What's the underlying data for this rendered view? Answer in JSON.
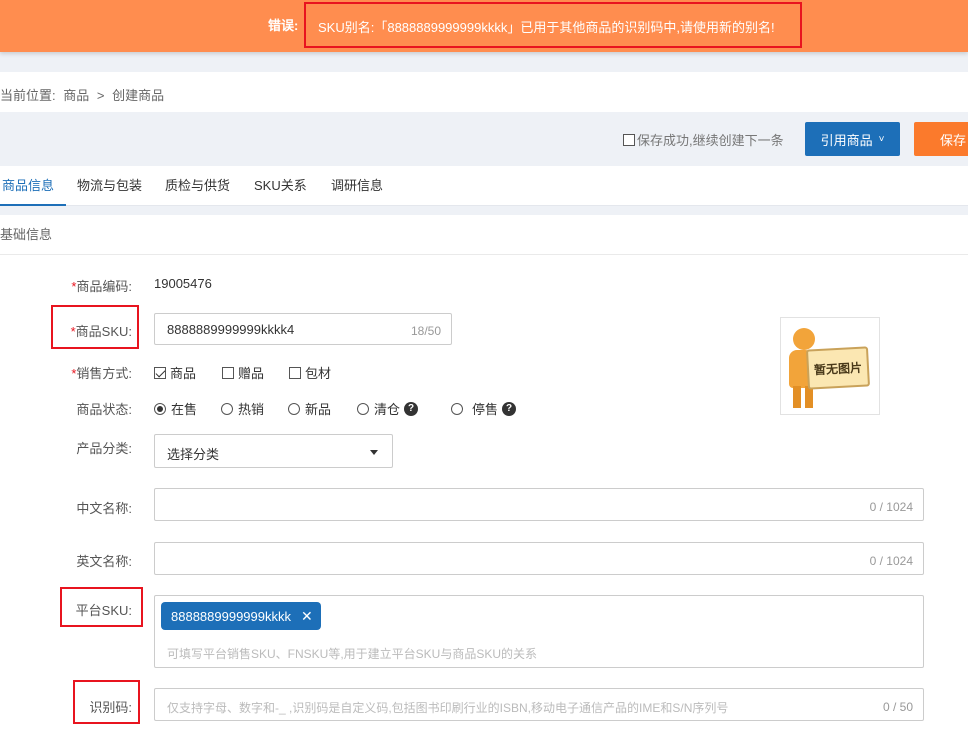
{
  "error": {
    "label": "错误:",
    "message": "SKU别名:「8888889999999kkkk」已用于其他商品的识别码中,请使用新的别名!"
  },
  "breadcrumb": {
    "prefix": "当前位置:",
    "items": [
      "商品",
      ">",
      "创建商品"
    ]
  },
  "toolbar": {
    "continue_label": "保存成功,继续创建下一条",
    "ref_button": "引用商品",
    "save_button": "保存"
  },
  "tabs": [
    {
      "label": "商品信息",
      "active": true
    },
    {
      "label": "物流与包装",
      "active": false
    },
    {
      "label": "质检与供货",
      "active": false
    },
    {
      "label": "SKU关系",
      "active": false
    },
    {
      "label": "调研信息",
      "active": false
    }
  ],
  "section": {
    "title": "基础信息"
  },
  "form": {
    "product_code": {
      "req": "*",
      "label": "商品编码:",
      "value": "19005476"
    },
    "product_sku": {
      "req": "*",
      "label": "商品SKU:",
      "value": "8888889999999kkkk4",
      "counter": "18/50"
    },
    "sale_mode": {
      "req": "*",
      "label": "销售方式:",
      "options": [
        {
          "label": "商品",
          "checked": true
        },
        {
          "label": "赠品",
          "checked": false
        },
        {
          "label": "包材",
          "checked": false
        }
      ]
    },
    "status": {
      "label": "商品状态:",
      "options": [
        {
          "label": "在售",
          "checked": true
        },
        {
          "label": "热销",
          "checked": false
        },
        {
          "label": "新品",
          "checked": false
        },
        {
          "label": "清仓",
          "checked": false
        },
        {
          "label": "停售",
          "checked": false
        }
      ]
    },
    "category": {
      "label": "产品分类:",
      "value": "选择分类"
    },
    "cn_name": {
      "label": "中文名称:",
      "counter": "0 / 1024"
    },
    "en_name": {
      "label": "英文名称:",
      "counter": "0 / 1024"
    },
    "platform_sku": {
      "label": "平台SKU:",
      "tag": "8888889999999kkkk",
      "placeholder": "可填写平台销售SKU、FNSKU等,用于建立平台SKU与商品SKU的关系"
    },
    "ident_code": {
      "label": "识别码:",
      "placeholder": "仅支持字母、数字和-_ ,识别码是自定义码,包括图书印刷行业的ISBN,移动电子通信产品的IME和S/N序列号",
      "counter": "0 / 50"
    }
  },
  "no_image": {
    "text": "暂无图片"
  },
  "colors": {
    "error_bar": "#ff8d4f",
    "primary": "#1d6fb8",
    "save": "#fb7a2c",
    "highlight": "#e8141f"
  }
}
